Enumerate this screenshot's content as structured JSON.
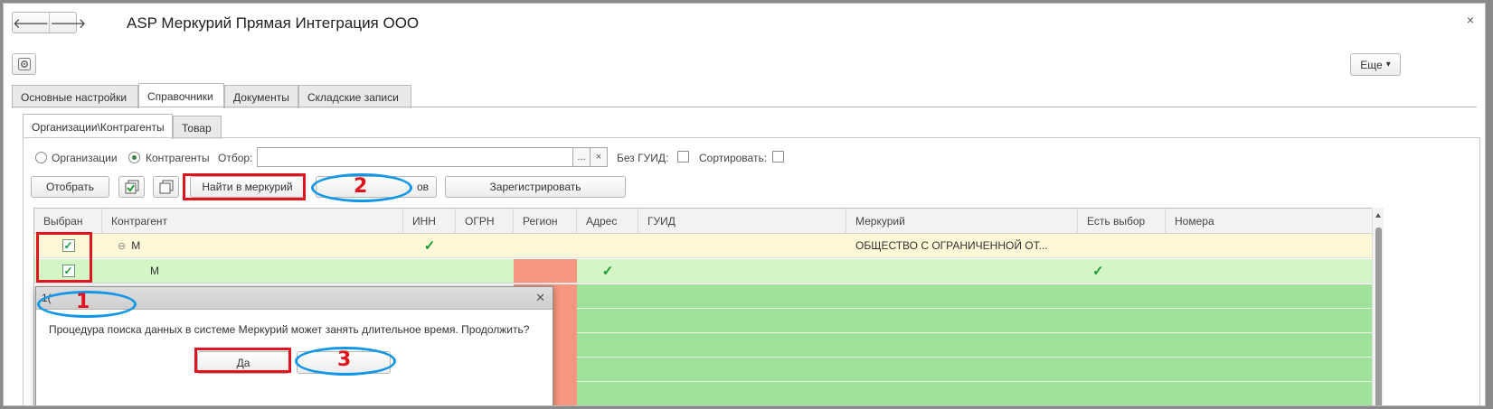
{
  "window": {
    "title": "ASP Меркурий Прямая Интеграция ООО",
    "close_glyph": "×",
    "back_glyph": "🡐",
    "fwd_glyph": "🡒",
    "more_label": "Еще",
    "more_caret": "▾",
    "settings_icon": "gear-icon"
  },
  "tabs": [
    "Основные настройки",
    "Справочники",
    "Документы",
    "Складские записи"
  ],
  "active_tab": "Справочники",
  "subtabs": [
    "Организации\\Контрагенты",
    "Товар"
  ],
  "active_subtab": "Организации\\Контрагенты",
  "filters": {
    "radio_org": "Организации",
    "radio_kontr": "Контрагенты",
    "selected_radio": "Контрагенты",
    "otbor_label": "Отбор:",
    "otbor_value": "",
    "dots": "...",
    "clear": "×",
    "bez_guid_label": "Без ГУИД:",
    "sort_label": "Сортировать:"
  },
  "toolbar": {
    "select_label": "Отобрать",
    "find_label": "Найти в меркурий",
    "hidden_suffix": "ов",
    "register_label": "Зарегистрировать"
  },
  "grid": {
    "columns": [
      "Выбран",
      "Контрагент",
      "ИНН",
      "ОГРН",
      "Регион",
      "Адрес",
      "ГУИД",
      "Меркурий",
      "Есть выбор",
      "Номера"
    ],
    "rows": [
      {
        "checked": true,
        "name": "М",
        "group": true,
        "inn_ok": true,
        "address_ok": false,
        "mercury": "ОБЩЕСТВО С ОГРАНИЧЕННОЙ ОТ...",
        "choice_ok": false
      },
      {
        "checked": true,
        "name": "М",
        "group": false,
        "inn_ok": false,
        "address_ok": true,
        "mercury": "",
        "choice_ok": true
      }
    ],
    "collapse_glyph": "⊖",
    "check_glyph": "✓"
  },
  "dialog": {
    "header_partial": "1(",
    "message": "Процедура поиска данных в системе Меркурий может занять длительное время. Продолжить?",
    "yes_label": "Да",
    "close_glyph": "✕"
  },
  "annotations": [
    "1",
    "2",
    "3"
  ],
  "colors": {
    "row_yellow": "#fff8d8",
    "row_green": "#d4f6c7",
    "region_red": "#f7977f",
    "body_green": "#a1e29b",
    "annotation_red": "#e0141e",
    "annotation_blue": "#1296e6"
  }
}
